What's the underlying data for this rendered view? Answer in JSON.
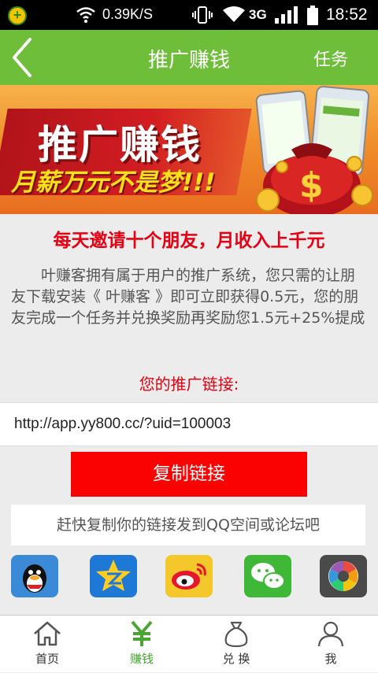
{
  "status_bar": {
    "speed": "0.39K/S",
    "network": "3G",
    "time": "18:52"
  },
  "header": {
    "title": "推广赚钱",
    "right_action": "任务"
  },
  "banner": {
    "title": "推广赚钱",
    "slogan": "月薪万元不是梦!!!"
  },
  "content": {
    "headline": "每天邀请十个朋友，月收入上千元",
    "description": "叶赚客拥有属于用户的推广系统，您只需的让朋友下载安装《 叶赚客 》即可立即获得0.5元，您的朋友完成一个任务并兑换奖励再奖励您1.5元+25%提成",
    "link_label": "您的推广链接:",
    "link": "http://app.yy800.cc/?uid=100003",
    "copy_button": "复制链接",
    "hint": "赶快复制你的链接发到QQ空间或论坛吧"
  },
  "share_targets": [
    "qq-icon",
    "qzone-icon",
    "weibo-icon",
    "wechat-icon",
    "moments-icon"
  ],
  "bottom_nav": [
    {
      "label": "首页",
      "icon": "home-icon"
    },
    {
      "label": "赚钱",
      "icon": "yuan-icon",
      "active": true
    },
    {
      "label": "兑 换",
      "icon": "money-bag-icon"
    },
    {
      "label": "我",
      "icon": "user-icon"
    }
  ],
  "colors": {
    "header_green": "#6fbe3a",
    "accent_red": "#e60012",
    "button_red": "#fb0202",
    "nav_active": "#4aa533"
  }
}
